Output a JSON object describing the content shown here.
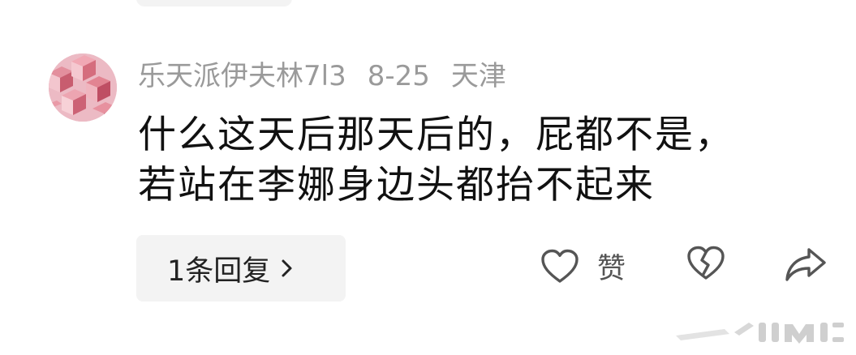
{
  "comment": {
    "username": "乐天派伊夫林7l3",
    "date": "8-25",
    "location": "天津",
    "text_lines": [
      "什么这天后那天后的，屁都不是，",
      "若站在李娜身边头都抬不起来"
    ]
  },
  "actions": {
    "reply_label": "1条回复",
    "like_label": "赞",
    "like_icon": "heart-outline-icon",
    "unlike_icon": "broken-heart-icon",
    "share_icon": "share-arrow-icon",
    "reply_icon": "chevron-right-icon"
  },
  "colors": {
    "meta_text": "#9a9a9a",
    "body_text": "#111111",
    "reply_bg": "#f3f3f3",
    "icon": "#555555"
  }
}
